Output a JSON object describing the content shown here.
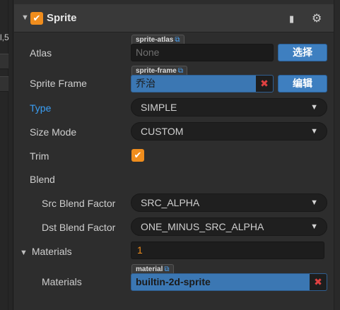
{
  "gutter": {
    "text": "l,5"
  },
  "component": {
    "title": "Sprite",
    "enabled": true
  },
  "atlas": {
    "label": "Atlas",
    "tag": "sprite-atlas",
    "value": "None",
    "button": "选择"
  },
  "sprite_frame": {
    "label": "Sprite Frame",
    "tag": "sprite-frame",
    "value": "乔治",
    "button": "编辑"
  },
  "type": {
    "label": "Type",
    "value": "SIMPLE"
  },
  "size_mode": {
    "label": "Size Mode",
    "value": "CUSTOM"
  },
  "trim": {
    "label": "Trim",
    "checked": true
  },
  "blend": {
    "label": "Blend"
  },
  "src_blend": {
    "label": "Src Blend Factor",
    "value": "SRC_ALPHA"
  },
  "dst_blend": {
    "label": "Dst Blend Factor",
    "value": "ONE_MINUS_SRC_ALPHA"
  },
  "materials": {
    "label": "Materials",
    "count": "1",
    "item_label": "Materials",
    "tag": "material",
    "value": "builtin-2d-sprite"
  },
  "icons": {
    "check": "✔",
    "expand": "▼",
    "caret": "▼",
    "clear": "✖",
    "external": "⧉",
    "book": "▮",
    "gear": "⚙"
  },
  "colors": {
    "accent": "#f08d1d",
    "highlight": "#3b77b3",
    "type_label": "#3a9ff6",
    "clear_x": "#e04141"
  }
}
